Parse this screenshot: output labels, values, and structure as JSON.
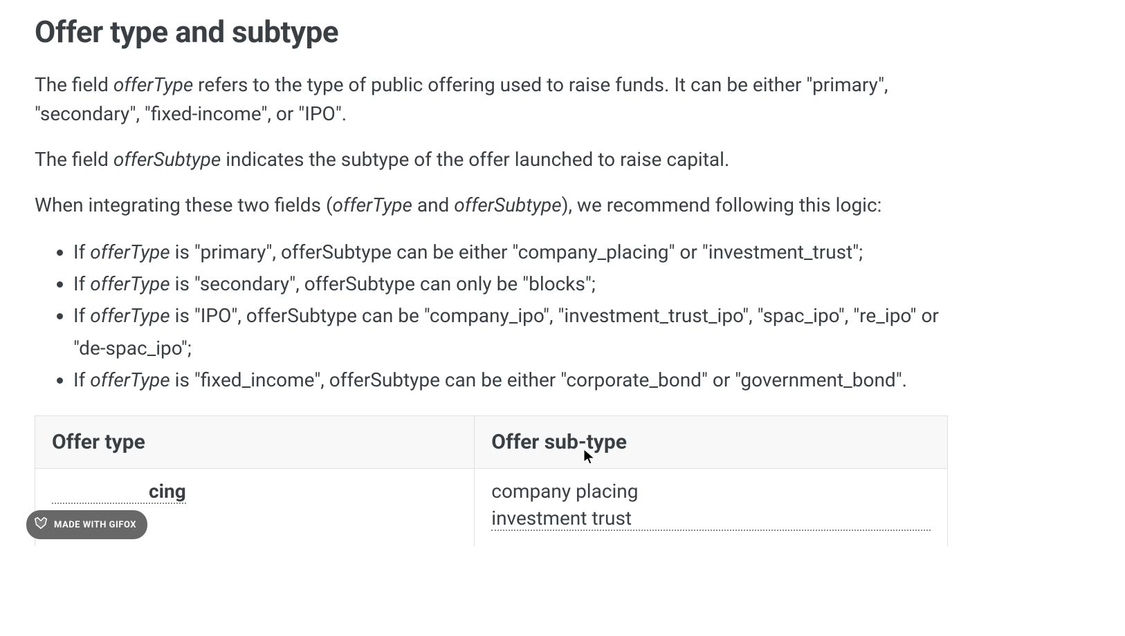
{
  "heading": "Offer type and subtype",
  "p1_a": "The field ",
  "p1_b": "offerType",
  "p1_c": " refers to the type of public offering used to raise funds. It can be either \"primary\", \"secondary\", \"fixed-income\", or \"IPO\".",
  "p2_a": "The field ",
  "p2_b": "offerSubtype",
  "p2_c": " indicates the subtype of the offer launched to raise capital.",
  "p3_a": "When integrating these two fields (",
  "p3_b": "offerType",
  "p3_c": " and ",
  "p3_d": "offerSubtype",
  "p3_e": "), we recommend following this logic:",
  "li1_a": "If ",
  "li1_b": "offerType",
  "li1_c": " is \"primary\", offerSubtype can be either \"company_placing\" or \"investment_trust\";",
  "li2_a": "If ",
  "li2_b": "offerType",
  "li2_c": " is \"secondary\", offerSubtype can only be \"blocks\";",
  "li3_a": "If ",
  "li3_b": "offerType",
  "li3_c": " is \"IPO\", offerSubtype can be \"company_ipo\", \"investment_trust_ipo\", \"spac_ipo\", \"re_ipo\" or \"de-spac_ipo\";",
  "li4_a": "If ",
  "li4_b": "offerType",
  "li4_c": " is \"fixed_income\", offerSubtype can be either \"corporate_bond\" or \"government_bond\".",
  "table": {
    "headers": [
      "Offer type",
      "Offer sub-type"
    ],
    "row1": {
      "type_text": "cing",
      "subtypes": [
        "company placing",
        "investment trust"
      ]
    }
  },
  "badge": "MADE WITH GIFOX"
}
